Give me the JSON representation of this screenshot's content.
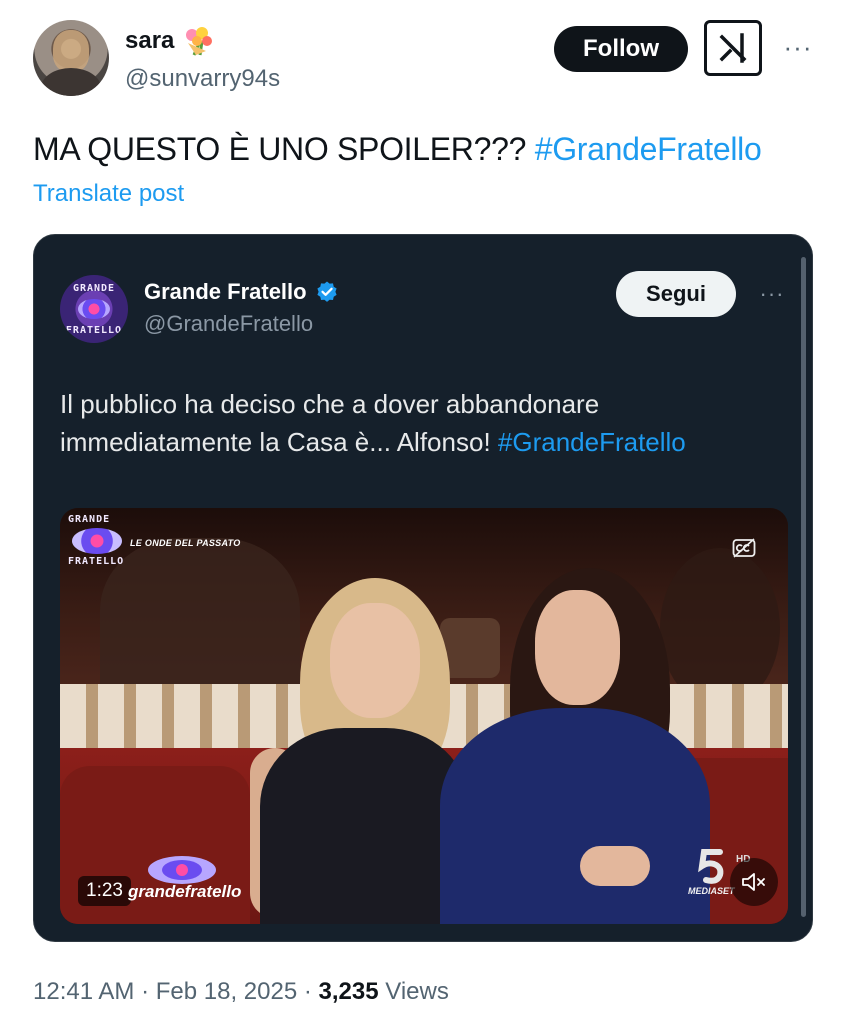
{
  "post": {
    "display_name": "sara",
    "handle": "@sunvarry94s",
    "follow_label": "Follow",
    "text": "MA QUESTO È UNO SPOILER??? ",
    "hashtag": "#GrandeFratello",
    "translate_label": "Translate post"
  },
  "quoted": {
    "display_name": "Grande Fratello",
    "handle": "@GrandeFratello",
    "follow_label": "Segui",
    "text": "Il pubblico ha deciso che a dover abbandonare immediatamente la Casa è... Alfonso! ",
    "hashtag": "#GrandeFratello",
    "avatar_text_top": "GRANDE",
    "avatar_text_bottom": "FRATELLO",
    "video": {
      "logo_top": "GRANDE",
      "logo_bottom": "FRATELLO",
      "segment_title": "LE ONDE DEL PASSATO",
      "duration": "1:23",
      "watermark": "grandefratello",
      "channel": "MEDIASET",
      "hd_badge": "HD"
    }
  },
  "meta": {
    "time": "12:41 AM",
    "separator": " · ",
    "date": "Feb 18, 2025",
    "views_count": "3,235",
    "views_label": " Views"
  },
  "icons": {
    "flower": "bouquet-emoji-icon",
    "grok": "grok-icon",
    "more": "more-horizontal-icon",
    "verified": "verified-badge-icon",
    "cc": "closed-captions-icon",
    "mute": "speaker-muted-icon"
  },
  "colors": {
    "accent": "#1d9bf0",
    "text": "#0f1419",
    "secondary": "#536471",
    "dark_card": "#15202b"
  }
}
